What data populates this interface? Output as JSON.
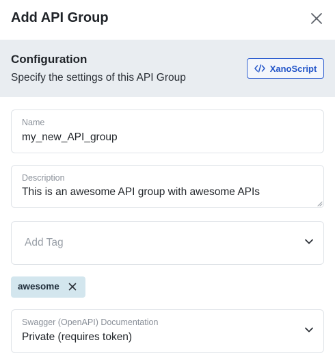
{
  "header": {
    "title": "Add API Group",
    "close_icon": "close-icon"
  },
  "config": {
    "title": "Configuration",
    "subtitle": "Specify the settings of this API Group",
    "xanoscript_label": "XanoScript",
    "xanoscript_icon": "code-icon"
  },
  "form": {
    "name": {
      "label": "Name",
      "value": "my_new_API_group"
    },
    "description": {
      "label": "Description",
      "value": "This is an awesome API group with awesome APIs"
    },
    "tags": {
      "placeholder": "Add Tag",
      "items": [
        {
          "label": "awesome"
        }
      ]
    },
    "swagger": {
      "label": "Swagger (OpenAPI) Documentation",
      "value": "Private (requires token)"
    }
  },
  "colors": {
    "accent": "#2456c9",
    "banner_bg": "#e9edf1",
    "chip_bg": "#d3e6ee",
    "border": "#dfe3e8"
  }
}
